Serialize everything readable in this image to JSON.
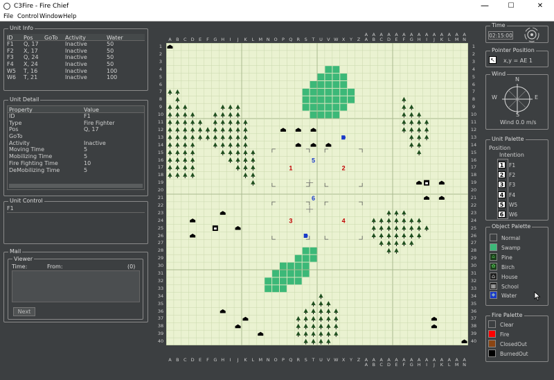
{
  "window": {
    "title": "C3Fire - Fire Chief",
    "min": "—",
    "max": "☐",
    "close": "✕"
  },
  "menu": [
    "File",
    "Control",
    "Window",
    "Help"
  ],
  "unit_info": {
    "title": "Unit Info",
    "headers": [
      "ID",
      "Pos",
      "GoTo",
      "Activity",
      "Water"
    ],
    "rows": [
      [
        "F1",
        "Q, 17",
        "",
        "Inactive",
        "50"
      ],
      [
        "F2",
        "X, 17",
        "",
        "Inactive",
        "50"
      ],
      [
        "F3",
        "Q, 24",
        "",
        "Inactive",
        "50"
      ],
      [
        "F4",
        "X, 24",
        "",
        "Inactive",
        "50"
      ],
      [
        "W5",
        "T, 16",
        "",
        "Inactive",
        "100"
      ],
      [
        "W6",
        "T, 21",
        "",
        "Inactive",
        "100"
      ]
    ]
  },
  "unit_detail": {
    "title": "Unit Detail",
    "headers": [
      "Property",
      "Value"
    ],
    "rows": [
      [
        "ID",
        "F1"
      ],
      [
        "Type",
        "Fire Fighter"
      ],
      [
        "Pos",
        "Q, 17"
      ],
      [
        "GoTo",
        ""
      ],
      [
        "Activity",
        "Inactive"
      ],
      [
        "Moving Time",
        "5"
      ],
      [
        "Mobilizing Time",
        "5"
      ],
      [
        "Fire Fighting Time",
        "10"
      ],
      [
        "DeMobilizing Time",
        "5"
      ]
    ]
  },
  "unit_control": {
    "title": "Unit Control",
    "value": "F1"
  },
  "mail": {
    "title": "Mail",
    "viewer": "Viewer",
    "time_label": "Time:",
    "from_label": "From:",
    "count": "(0)",
    "next": "Next"
  },
  "time": {
    "title": "Time",
    "value": "02:15:00"
  },
  "pointer": {
    "title": "Pointer Position",
    "value": "x,y = AE 1"
  },
  "wind": {
    "title": "Wind",
    "n": "N",
    "s": "S",
    "e": "E",
    "w": "W",
    "value": "Wind 0.0 m/s"
  },
  "unit_palette": {
    "title": "Unit Palette",
    "position": "Position",
    "intention": "Intention",
    "units": [
      {
        "num": "1",
        "id": "F1"
      },
      {
        "num": "2",
        "id": "F2"
      },
      {
        "num": "3",
        "id": "F3"
      },
      {
        "num": "4",
        "id": "F4"
      },
      {
        "num": "5",
        "id": "W5"
      },
      {
        "num": "6",
        "id": "W6"
      }
    ]
  },
  "object_palette": {
    "title": "Object Palette",
    "items": [
      {
        "label": "Normal",
        "icon": "normal-swatch",
        "color": "#3c3f41"
      },
      {
        "label": "Swamp",
        "icon": "swamp-swatch",
        "color": "#3cb878"
      },
      {
        "label": "Pine",
        "icon": "pine-icon",
        "color": "#2e6b2e"
      },
      {
        "label": "Birch",
        "icon": "birch-icon",
        "color": "#2e8b2e"
      },
      {
        "label": "House",
        "icon": "house-icon",
        "color": "#000000"
      },
      {
        "label": "School",
        "icon": "school-icon",
        "color": "#000000"
      },
      {
        "label": "Water",
        "icon": "water-icon",
        "color": "#1a3ac8"
      }
    ]
  },
  "fire_palette": {
    "title": "Fire Palette",
    "items": [
      {
        "label": "Clear",
        "color": "#3c3f41"
      },
      {
        "label": "Fire",
        "color": "#ff0000"
      },
      {
        "label": "ClosedOut",
        "color": "#8b4513"
      },
      {
        "label": "BurnedOut",
        "color": "#000000"
      }
    ]
  },
  "map": {
    "col_labels": [
      "A",
      "B",
      "C",
      "D",
      "E",
      "F",
      "G",
      "H",
      "I",
      "J",
      "K",
      "L",
      "M",
      "N",
      "O",
      "P",
      "Q",
      "R",
      "S",
      "T",
      "U",
      "V",
      "W",
      "X",
      "Y",
      "Z",
      "AA",
      "AB",
      "AC",
      "AD",
      "AE",
      "AF",
      "AG",
      "AH",
      "AI",
      "AJ",
      "AK",
      "AL",
      "AM",
      "AN"
    ],
    "row_labels": [
      "1",
      "2",
      "3",
      "4",
      "5",
      "6",
      "7",
      "8",
      "9",
      "10",
      "11",
      "12",
      "13",
      "14",
      "15",
      "16",
      "17",
      "18",
      "19",
      "20",
      "21",
      "22",
      "23",
      "24",
      "25",
      "26",
      "27",
      "28",
      "29",
      "30",
      "31",
      "32",
      "33",
      "34",
      "35",
      "36",
      "37",
      "38",
      "39",
      "40"
    ],
    "swamp_rows": [
      "",
      "",
      "",
      "21-22",
      "20-23",
      "19-23",
      "18-24",
      "18-24",
      "18-23",
      "19-22",
      "",
      "",
      "",
      "",
      "",
      "",
      "",
      "",
      "",
      "",
      "",
      "",
      "",
      "",
      "",
      "",
      "",
      "18-19",
      "17-19",
      "15-18",
      "14-18",
      "13-17",
      "13-15",
      "",
      "",
      "",
      "",
      "",
      "",
      ""
    ],
    "trees": [
      "0,6",
      "1,6",
      "1,7",
      "0,8",
      "1,8",
      "2,8",
      "0,9",
      "1,9",
      "2,9",
      "3,9",
      "0,10",
      "1,10",
      "2,10",
      "3,10",
      "4,10",
      "0,11",
      "1,11",
      "2,11",
      "3,11",
      "4,11",
      "5,11",
      "0,12",
      "1,12",
      "2,12",
      "3,12",
      "4,12",
      "0,13",
      "1,13",
      "2,13",
      "3,13",
      "0,14",
      "1,14",
      "2,14",
      "3,14",
      "0,15",
      "1,15",
      "2,15",
      "3,15",
      "0,16",
      "1,16",
      "2,16",
      "3,16",
      "0,17",
      "1,17",
      "2,17",
      "3,17",
      "7,8",
      "8,8",
      "9,8",
      "6,9",
      "7,9",
      "8,9",
      "9,9",
      "6,10",
      "7,10",
      "8,10",
      "9,10",
      "10,10",
      "5,11",
      "6,11",
      "7,11",
      "8,11",
      "9,11",
      "10,11",
      "5,12",
      "6,12",
      "7,12",
      "8,12",
      "9,12",
      "10,12",
      "6,13",
      "7,13",
      "8,13",
      "9,13",
      "10,13",
      "7,14",
      "8,14",
      "9,14",
      "10,14",
      "11,14",
      "8,15",
      "9,15",
      "10,15",
      "11,15",
      "9,16",
      "10,16",
      "11,16",
      "10,17",
      "11,17",
      "11,18",
      "31,7",
      "31,8",
      "32,8",
      "31,9",
      "32,9",
      "33,9",
      "31,10",
      "32,10",
      "33,10",
      "34,10",
      "31,11",
      "32,11",
      "33,11",
      "34,11",
      "32,12",
      "33,12",
      "34,12",
      "32,13",
      "33,13",
      "33,14",
      "29,22",
      "30,22",
      "31,22",
      "27,23",
      "28,23",
      "29,23",
      "30,23",
      "31,23",
      "32,23",
      "33,23",
      "27,24",
      "28,24",
      "29,24",
      "30,24",
      "31,24",
      "32,24",
      "33,24",
      "34,24",
      "27,25",
      "28,25",
      "29,25",
      "30,25",
      "31,25",
      "32,25",
      "33,25",
      "28,26",
      "29,26",
      "30,26",
      "31,26",
      "32,26",
      "29,27",
      "30,27",
      "20,33",
      "19,34",
      "20,34",
      "21,34",
      "18,35",
      "19,35",
      "20,35",
      "21,35",
      "22,35",
      "17,36",
      "18,36",
      "19,36",
      "20,36",
      "21,36",
      "22,36",
      "17,37",
      "18,37",
      "19,37",
      "20,37",
      "21,37",
      "22,37",
      "17,38",
      "18,38",
      "19,38",
      "20,38",
      "21,38",
      "22,38",
      "18,39",
      "19,39",
      "20,39",
      "21,39"
    ],
    "houses": [
      "0,0",
      "15,11",
      "17,11",
      "19,11",
      "17,13",
      "19,13",
      "21,13",
      "33,18",
      "36,18",
      "34,20",
      "36,20",
      "7,22",
      "3,23",
      "9,24",
      "3,25",
      "7,35",
      "10,36",
      "9,37",
      "12,38",
      "35,36",
      "35,37",
      "39,39"
    ],
    "schools": [
      "34,18",
      "6,24"
    ],
    "waters": [
      "23,12",
      "18,25"
    ],
    "units": [
      {
        "id": "1",
        "c": 16,
        "r": 16
      },
      {
        "id": "2",
        "c": 23,
        "r": 16
      },
      {
        "id": "3",
        "c": 16,
        "r": 23
      },
      {
        "id": "4",
        "c": 23,
        "r": 23
      },
      {
        "id": "5",
        "c": 19,
        "r": 15
      },
      {
        "id": "6",
        "c": 19,
        "r": 20
      }
    ]
  }
}
